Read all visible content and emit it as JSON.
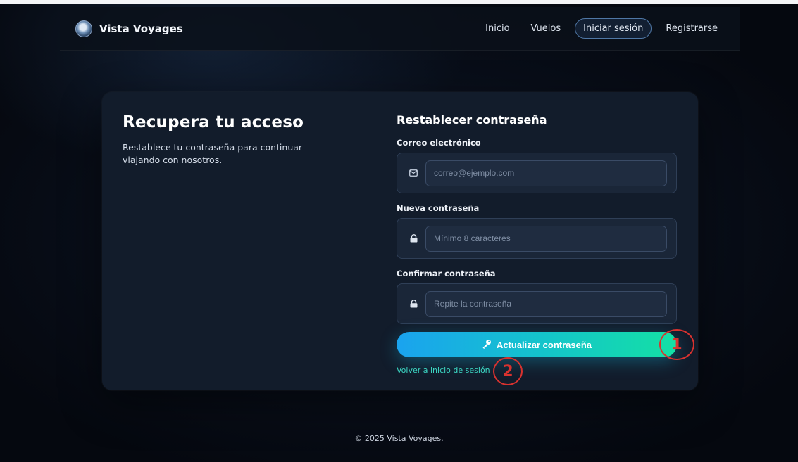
{
  "brand": {
    "name": "Vista Voyages",
    "logo_icon": "globe-logo-icon"
  },
  "nav": {
    "items": [
      {
        "label": "Inicio"
      },
      {
        "label": "Vuelos"
      },
      {
        "label": "Iniciar sesión",
        "active": true
      },
      {
        "label": "Registrarse"
      }
    ]
  },
  "intro": {
    "title": "Recupera tu acceso",
    "description": "Restablece tu contraseña para continuar viajando con nosotros."
  },
  "form": {
    "title": "Restablecer contraseña",
    "email": {
      "label": "Correo electrónico",
      "placeholder": "correo@ejemplo.com",
      "icon": "envelope-icon"
    },
    "new_password": {
      "label": "Nueva contraseña",
      "placeholder": "Mínimo 8 caracteres",
      "icon": "lock-icon"
    },
    "confirm_password": {
      "label": "Confirmar contraseña",
      "placeholder": "Repite la contraseña",
      "icon": "lock-icon"
    },
    "submit_label": "Actualizar contraseña",
    "submit_icon": "key-icon",
    "back_link": "Volver a inicio de sesión"
  },
  "annotations": [
    "1",
    "2"
  ],
  "footer": {
    "text": "© 2025 Vista Voyages."
  },
  "colors": {
    "accent_start": "#1aa3ef",
    "accent_end": "#14e0a4",
    "link": "#3cd7c4",
    "annotation": "#d8322f"
  }
}
